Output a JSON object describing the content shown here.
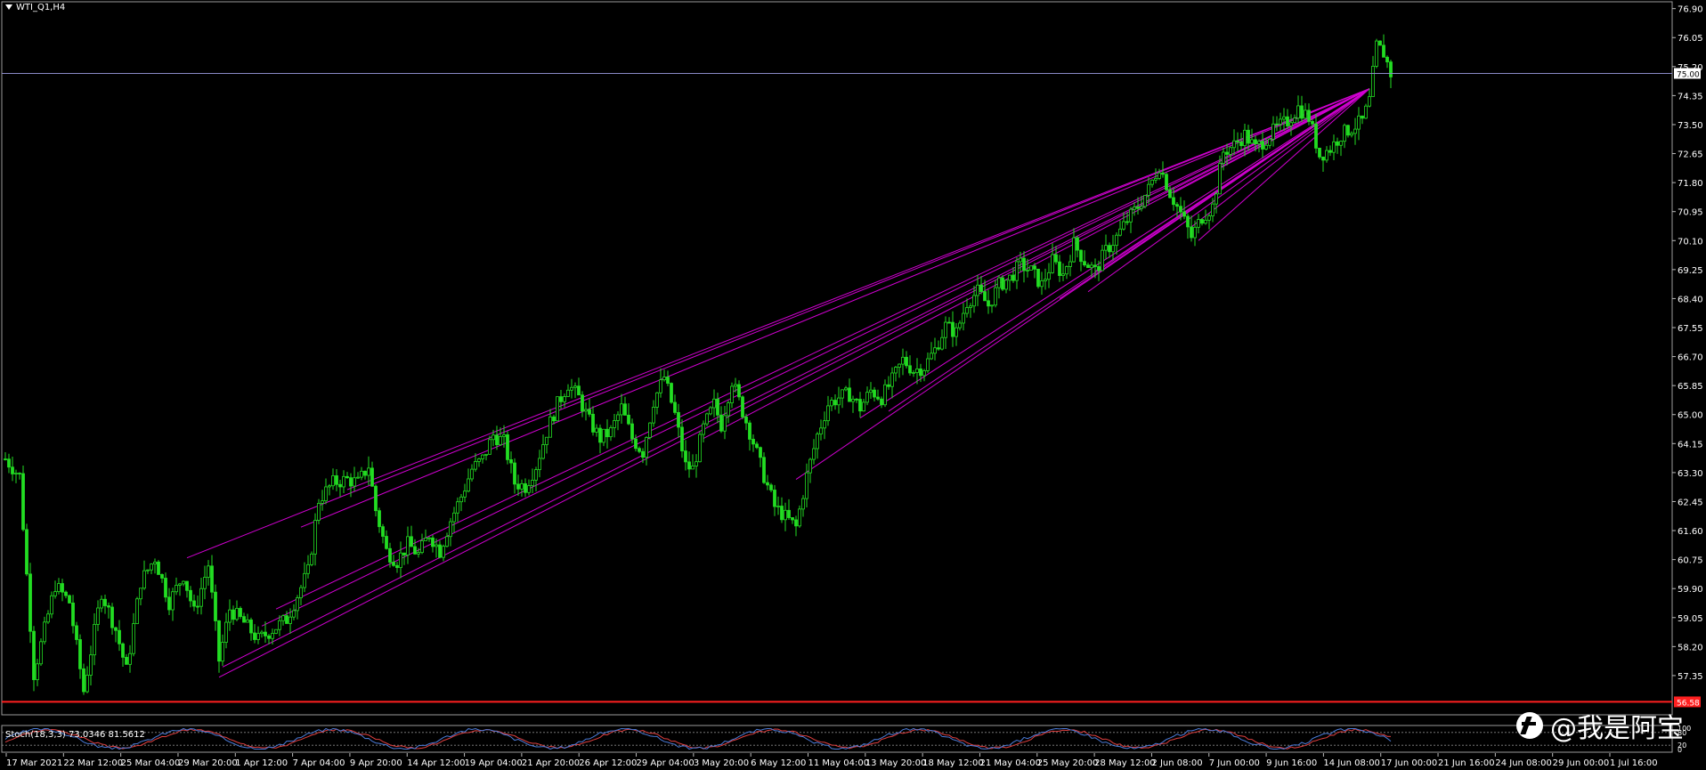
{
  "window": {
    "symbol_label": "WTI_Q1,H4"
  },
  "indicator": {
    "label": "Stoch(18,3,3) 73.0346 81.5612"
  },
  "watermark": {
    "text": "@我是阿宝"
  },
  "colors": {
    "background": "#000000",
    "axis": "#ffffff",
    "bull_candle": "#22dd22",
    "bear_candle": "#22dd22",
    "trendline": "#d000d0",
    "current_price_line": "#8a8ac8",
    "support_line": "#ff2020",
    "stoch_main": "#4b7bd8",
    "stoch_signal": "#e04040"
  },
  "chart_data": {
    "type": "candlestick",
    "timeframe": "H4",
    "y_ticks": [
      "76.90",
      "76.05",
      "75.20",
      "74.35",
      "73.50",
      "72.65",
      "71.80",
      "70.95",
      "70.10",
      "69.25",
      "68.40",
      "67.55",
      "66.70",
      "65.85",
      "65.00",
      "64.15",
      "63.30",
      "62.45",
      "61.60",
      "60.75",
      "59.90",
      "59.05",
      "58.20",
      "57.35",
      "56.50"
    ],
    "ylim": [
      56.2,
      77.1
    ],
    "x_ticks": [
      "17 Mar 2021",
      "22 Mar 12:00",
      "25 Mar 04:00",
      "29 Mar 20:00",
      "1 Apr 12:00",
      "7 Apr 04:00",
      "9 Apr 20:00",
      "14 Apr 12:00",
      "19 Apr 04:00",
      "21 Apr 20:00",
      "26 Apr 12:00",
      "29 Apr 04:00",
      "3 May 20:00",
      "6 May 12:00",
      "11 May 04:00",
      "13 May 20:00",
      "18 May 12:00",
      "21 May 04:00",
      "25 May 20:00",
      "28 May 12:00",
      "2 Jun 08:00",
      "7 Jun 00:00",
      "9 Jun 16:00",
      "14 Jun 08:00",
      "17 Jun 00:00",
      "21 Jun 16:00",
      "24 Jun 08:00",
      "29 Jun 00:00",
      "1 Jul 16:00"
    ],
    "current_price": "75.00",
    "support_price": "56.58",
    "stoch_ticks": [
      "100",
      "80",
      "20",
      "0"
    ],
    "stochastic": {
      "period": "18,3,3",
      "main": 73.0346,
      "signal": 81.5612
    },
    "close_path": [
      [
        0,
        63.7
      ],
      [
        4,
        63.2
      ],
      [
        8,
        57.4
      ],
      [
        14,
        60.0
      ],
      [
        18,
        59.5
      ],
      [
        22,
        56.9
      ],
      [
        27,
        59.8
      ],
      [
        31,
        58.7
      ],
      [
        34,
        57.5
      ],
      [
        38,
        60.1
      ],
      [
        42,
        60.8
      ],
      [
        46,
        59.5
      ],
      [
        50,
        60.3
      ],
      [
        53,
        59.2
      ],
      [
        57,
        60.6
      ],
      [
        60,
        57.8
      ],
      [
        63,
        59.3
      ],
      [
        67,
        58.9
      ],
      [
        71,
        58.4
      ],
      [
        75,
        58.7
      ],
      [
        79,
        59.0
      ],
      [
        82,
        59.7
      ],
      [
        85,
        60.4
      ],
      [
        88,
        62.5
      ],
      [
        92,
        63.0
      ],
      [
        96,
        63.1
      ],
      [
        99,
        63.0
      ],
      [
        102,
        63.5
      ],
      [
        104,
        62.2
      ],
      [
        107,
        61.0
      ],
      [
        110,
        60.7
      ],
      [
        113,
        61.2
      ],
      [
        116,
        60.9
      ],
      [
        119,
        61.5
      ],
      [
        122,
        61.0
      ],
      [
        125,
        61.9
      ],
      [
        128,
        62.6
      ],
      [
        131,
        63.4
      ],
      [
        134,
        63.7
      ],
      [
        137,
        64.4
      ],
      [
        140,
        64.2
      ],
      [
        143,
        63.0
      ],
      [
        146,
        62.9
      ],
      [
        149,
        63.5
      ],
      [
        152,
        64.5
      ],
      [
        155,
        65.3
      ],
      [
        158,
        65.9
      ],
      [
        161,
        65.5
      ],
      [
        164,
        64.8
      ],
      [
        167,
        64.3
      ],
      [
        170,
        64.5
      ],
      [
        173,
        65.2
      ],
      [
        176,
        64.3
      ],
      [
        179,
        63.9
      ],
      [
        182,
        65.4
      ],
      [
        185,
        66.1
      ],
      [
        188,
        65.0
      ],
      [
        191,
        63.5
      ],
      [
        193,
        63.4
      ],
      [
        196,
        64.6
      ],
      [
        199,
        65.3
      ],
      [
        201,
        64.7
      ],
      [
        204,
        66.0
      ],
      [
        207,
        65.1
      ],
      [
        210,
        64.2
      ],
      [
        213,
        63.2
      ],
      [
        216,
        62.3
      ],
      [
        219,
        62.0
      ],
      [
        222,
        61.7
      ],
      [
        225,
        63.2
      ],
      [
        228,
        64.4
      ],
      [
        231,
        65.3
      ],
      [
        234,
        65.5
      ],
      [
        237,
        65.6
      ],
      [
        240,
        65.2
      ],
      [
        243,
        65.7
      ],
      [
        246,
        65.5
      ],
      [
        249,
        66.0
      ],
      [
        252,
        66.6
      ],
      [
        255,
        66.3
      ],
      [
        258,
        66.4
      ],
      [
        261,
        66.9
      ],
      [
        264,
        67.6
      ],
      [
        267,
        67.4
      ],
      [
        270,
        68.3
      ],
      [
        273,
        68.6
      ],
      [
        276,
        68.2
      ],
      [
        279,
        68.8
      ],
      [
        282,
        69.0
      ],
      [
        285,
        69.4
      ],
      [
        288,
        69.2
      ],
      [
        291,
        68.8
      ],
      [
        294,
        69.5
      ],
      [
        297,
        69.1
      ],
      [
        300,
        70.0
      ],
      [
        303,
        69.5
      ],
      [
        306,
        69.2
      ],
      [
        309,
        69.8
      ],
      [
        312,
        70.2
      ],
      [
        315,
        70.7
      ],
      [
        318,
        71.1
      ],
      [
        321,
        71.6
      ],
      [
        324,
        72.3
      ],
      [
        327,
        71.5
      ],
      [
        330,
        70.9
      ],
      [
        333,
        70.2
      ],
      [
        336,
        70.8
      ],
      [
        339,
        71.1
      ],
      [
        342,
        72.7
      ],
      [
        345,
        72.9
      ],
      [
        348,
        73.2
      ],
      [
        351,
        72.8
      ],
      [
        354,
        73.1
      ],
      [
        357,
        73.4
      ],
      [
        360,
        73.6
      ],
      [
        363,
        74.0
      ],
      [
        366,
        73.7
      ],
      [
        369,
        72.6
      ],
      [
        372,
        72.8
      ],
      [
        375,
        73.2
      ],
      [
        378,
        73.4
      ],
      [
        381,
        73.6
      ],
      [
        383,
        74.2
      ],
      [
        385,
        75.8
      ],
      [
        387,
        75.6
      ],
      [
        389,
        75.0
      ]
    ],
    "trendlines_from": [
      [
        83,
        61.7
      ],
      [
        51,
        60.8
      ],
      [
        96,
        62.8
      ],
      [
        72,
        58.8
      ],
      [
        76,
        59.3
      ],
      [
        60,
        57.3
      ],
      [
        61,
        57.6
      ],
      [
        196,
        64.3
      ],
      [
        222,
        63.1
      ],
      [
        248,
        65.1
      ],
      [
        240,
        64.9
      ],
      [
        304,
        68.6
      ],
      [
        306,
        69.2
      ],
      [
        296,
        68.4
      ],
      [
        328,
        71.5
      ],
      [
        333,
        70.5
      ],
      [
        335,
        70.1
      ],
      [
        346,
        72.7
      ],
      [
        350,
        72.9
      ]
    ],
    "trendline_apex": [
      383,
      74.55
    ]
  }
}
